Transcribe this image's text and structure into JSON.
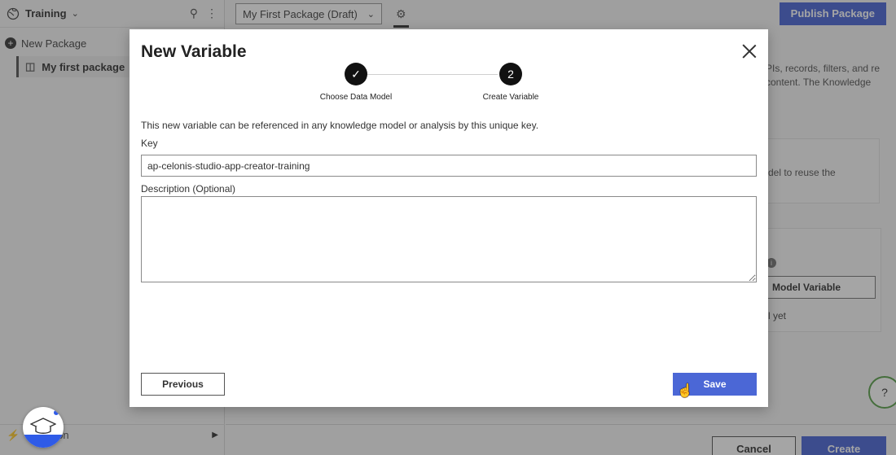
{
  "sidebar": {
    "workspace": "Training",
    "new_package": "New Package",
    "package_item": "My first package",
    "bottom_item": "on"
  },
  "topbar": {
    "package_select": "My First Package (Draft)",
    "publish_label": "Publish Package"
  },
  "background": {
    "text1": "PIs, records, filters, and re content. The Knowledge",
    "text2": "del to reuse the",
    "model_variable": "Model Variable",
    "none_yet": "l yet",
    "help": "?"
  },
  "footer": {
    "cancel_label": "Cancel",
    "create_label": "Create"
  },
  "modal": {
    "title": "New Variable",
    "steps": [
      {
        "number": "✓",
        "label": "Choose Data Model",
        "status": "done"
      },
      {
        "number": "2",
        "label": "Create Variable",
        "status": "active"
      }
    ],
    "description": "This new variable can be referenced in any knowledge model or analysis by this unique key.",
    "key_label": "Key",
    "key_value": "ap-celonis-studio-app-creator-training",
    "description_label": "Description (Optional)",
    "description_value": "",
    "previous_label": "Previous",
    "save_label": "Save"
  }
}
